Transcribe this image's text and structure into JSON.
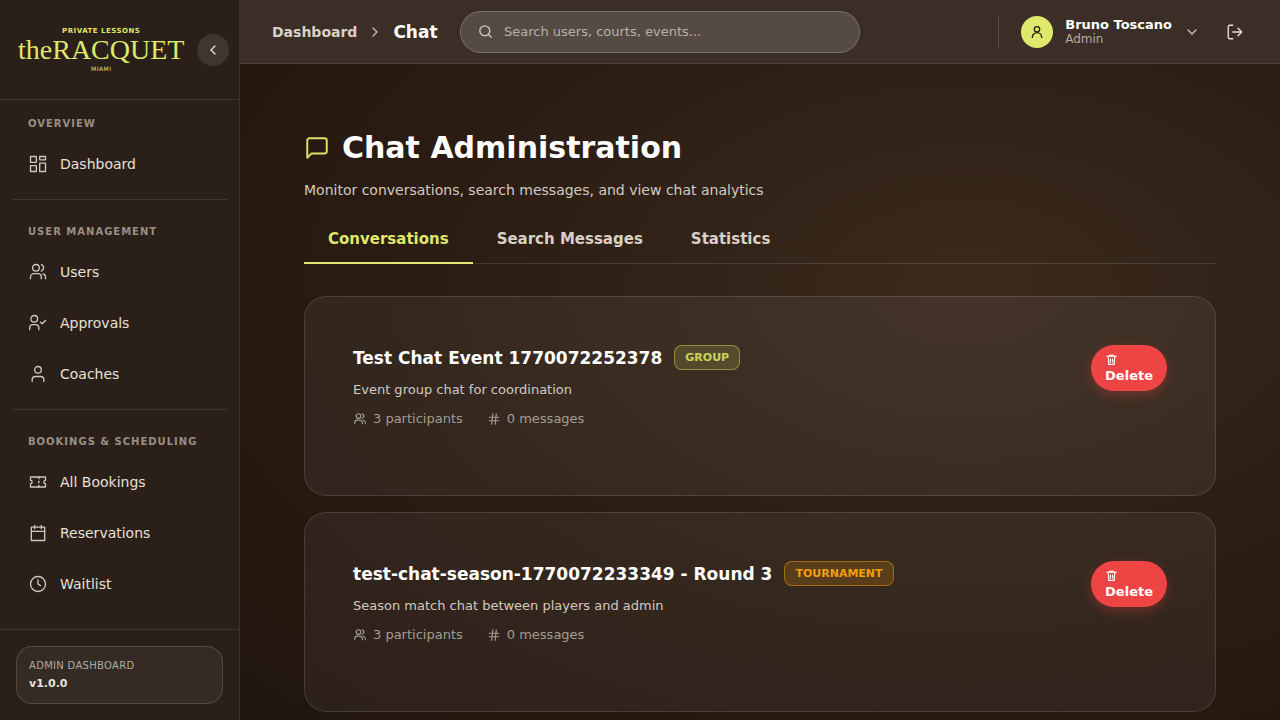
{
  "logo": {
    "tagline": "PRIVATE LESSONS",
    "name": "theRACQUET",
    "location": "MIAMI"
  },
  "sidebar": {
    "sections": [
      {
        "label": "OVERVIEW",
        "items": [
          {
            "label": "Dashboard",
            "selected": false
          }
        ]
      },
      {
        "label": "USER MANAGEMENT",
        "items": [
          {
            "label": "Users",
            "selected": false
          },
          {
            "label": "Approvals",
            "selected": false
          },
          {
            "label": "Coaches",
            "selected": false
          }
        ]
      },
      {
        "label": "BOOKINGS & SCHEDULING",
        "items": [
          {
            "label": "All Bookings",
            "selected": false
          },
          {
            "label": "Reservations",
            "selected": false
          },
          {
            "label": "Waitlist",
            "selected": false
          }
        ]
      }
    ],
    "footer": {
      "label": "ADMIN DASHBOARD",
      "version": "v1.0.0"
    }
  },
  "breadcrumb": [
    {
      "label": "Dashboard",
      "current": false
    },
    {
      "label": "Chat",
      "current": true
    }
  ],
  "search": {
    "placeholder": "Search users, courts, events..."
  },
  "user": {
    "name": "Bruno Toscano",
    "role": "Admin"
  },
  "page": {
    "title": "Chat Administration",
    "subtitle": "Monitor conversations, search messages, and view chat analytics"
  },
  "tabs": [
    {
      "label": "Conversations",
      "selected": true
    },
    {
      "label": "Search Messages",
      "selected": false
    },
    {
      "label": "Statistics",
      "selected": false
    }
  ],
  "conversations": [
    {
      "title": "Test Chat Event 1770072252378",
      "badge": "GROUP",
      "color": "#c9d45a",
      "description": "Event group chat for coordination",
      "participants": "3 participants",
      "messages": "0 messages",
      "action": "Delete"
    },
    {
      "title": "test-chat-season-1770072233349 - Round 3",
      "badge": "TOURNAMENT",
      "color": "#f59e0b",
      "description": "Season match chat between players and admin",
      "participants": "3 participants",
      "messages": "0 messages",
      "action": "Delete"
    }
  ]
}
